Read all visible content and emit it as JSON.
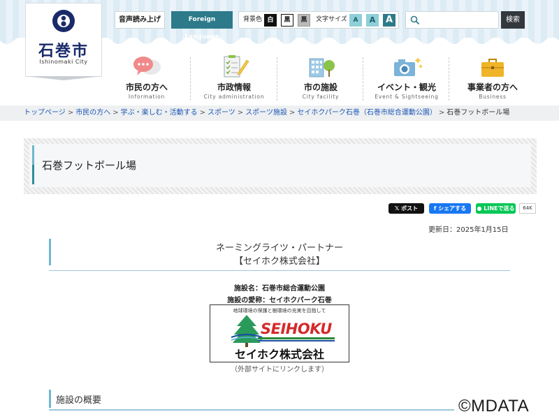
{
  "header": {
    "logo_name": "石巻市",
    "logo_sub": "Ishinomaki City",
    "voice_label": "音声読み上げ",
    "foreign_label": "Foreign Language",
    "bg_color_label": "背景色",
    "bg_options": [
      "白",
      "黒",
      "黒"
    ],
    "font_size_label": "文字サイズ",
    "font_sizes": [
      "A",
      "A",
      "A"
    ],
    "search_placeholder": "",
    "search_button": "検索"
  },
  "nav": [
    {
      "label": "市民の方へ",
      "sub": "Information",
      "icon": "speech-bubbles-icon"
    },
    {
      "label": "市政情報",
      "sub": "City administration",
      "icon": "clipboard-pencil-icon"
    },
    {
      "label": "市の施設",
      "sub": "City facility",
      "icon": "building-tree-icon"
    },
    {
      "label": "イベント・観光",
      "sub": "Event & Sightseeing",
      "icon": "camera-icon"
    },
    {
      "label": "事業者の方へ",
      "sub": "Business",
      "icon": "briefcase-icon"
    }
  ],
  "breadcrumb": [
    "トップページ",
    "市民の方へ",
    "学ぶ・楽しむ・活動する",
    "スポーツ",
    "スポーツ施設",
    "セイホクパーク石巻（石巻市総合運動公園）"
  ],
  "breadcrumb_current": "石巻フットボール場",
  "page_title": "石巻フットボール場",
  "share": {
    "x_label": "ポスト",
    "fb_label": "シェアする",
    "line_label": "LINEで送る",
    "count": "64K"
  },
  "updated": "更新日：2025年1月15日",
  "content": {
    "heading_line1": "ネーミングライツ・パートナー",
    "heading_line2": "【セイホク株式会社】",
    "facility_name": "施設名：石巻市総合運動公園",
    "facility_nickname": "施設の愛称：セイホクパーク石巻",
    "banner_tagline": "地球環境の保護と樹環境の充実を目指して",
    "banner_logo": "SEIHOKU",
    "banner_company": "セイホク株式会社",
    "external_note": "（外部サイトにリンクします）",
    "section_heading": "施設の概要"
  },
  "watermark": "©MDATA",
  "colors": {
    "accent_teal": "#2d7a8a",
    "link_blue": "#1e58b4",
    "heading_bar": "#6fb7cf",
    "banner_red": "#d42a2a"
  }
}
